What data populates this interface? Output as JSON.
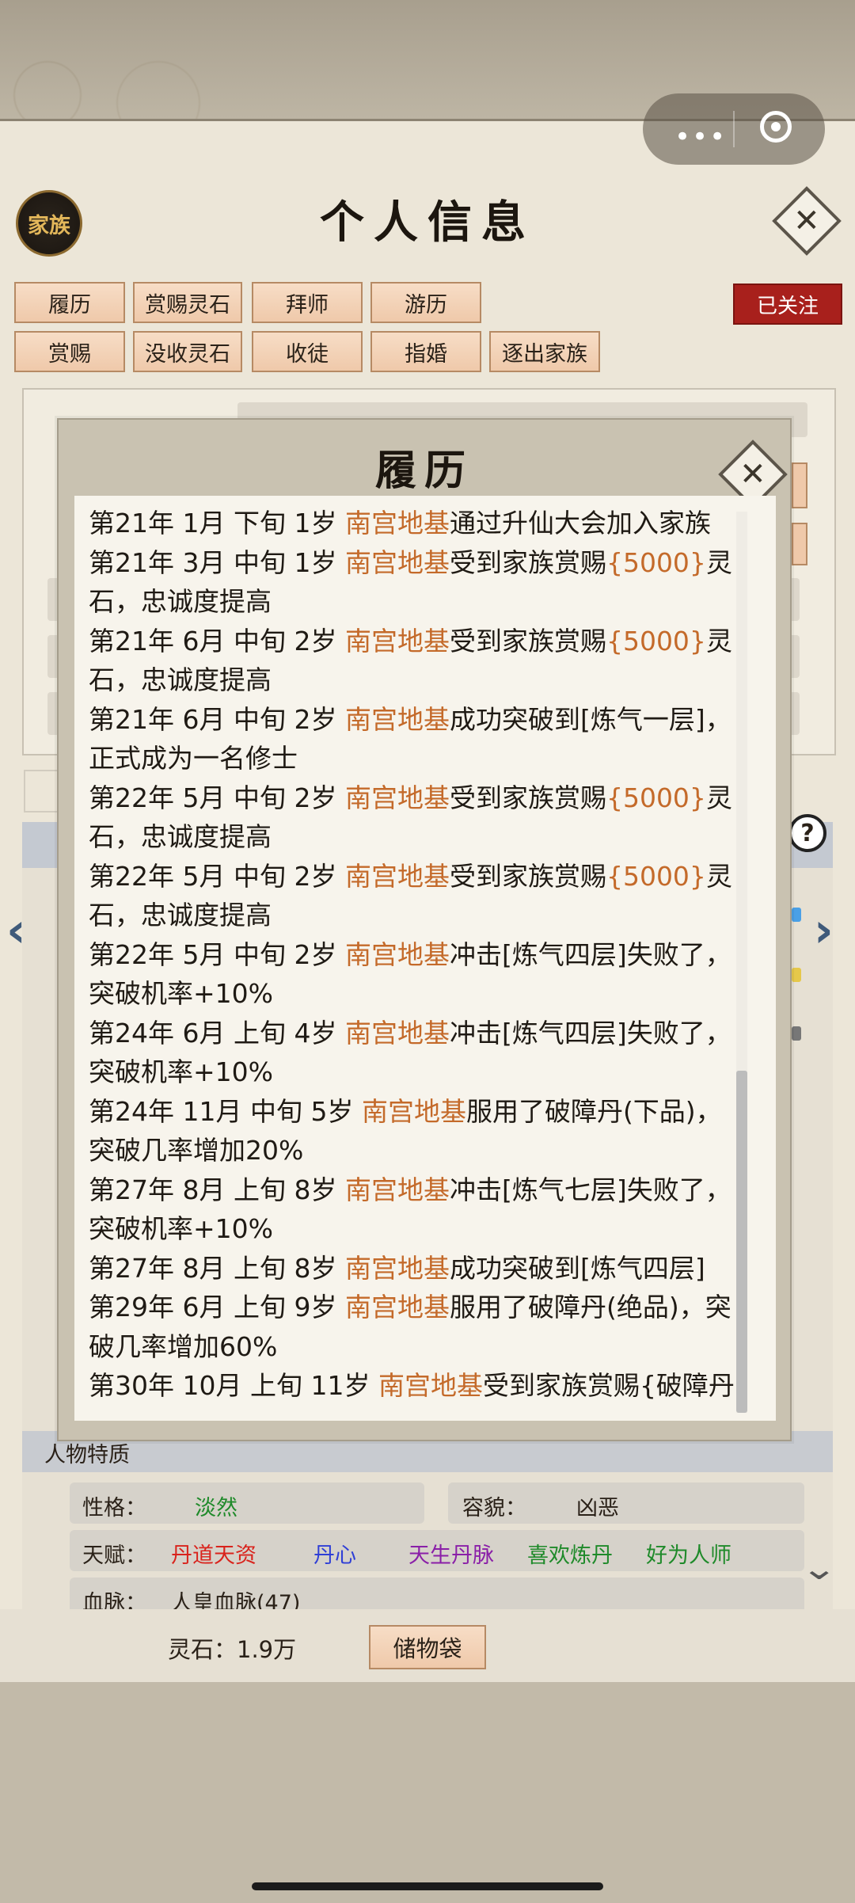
{
  "header": {
    "family_label": "家族",
    "title": "个人信息",
    "close_symbol": "✕"
  },
  "actions": {
    "row1": [
      "履历",
      "赏赐灵石",
      "拜师",
      "游历"
    ],
    "row2": [
      "赏赐",
      "没收灵石",
      "收徒",
      "指婚",
      "逐出家族"
    ],
    "followed_label": "已关注"
  },
  "dialog": {
    "title": "履历",
    "close_symbol": "✕",
    "entries": [
      {
        "pre": "第21年 1月 下旬 1岁 ",
        "name": "南宫地基",
        "post": "通过升仙大会加入家族"
      },
      {
        "pre": "第21年 3月 中旬 1岁 ",
        "name": "南宫地基",
        "post": "受到家族赏赐",
        "reward": "{5000}",
        "tail": "灵石，忠诚度提高"
      },
      {
        "pre": "第21年 6月 中旬 2岁 ",
        "name": "南宫地基",
        "post": "受到家族赏赐",
        "reward": "{5000}",
        "tail": "灵石，忠诚度提高"
      },
      {
        "pre": "第21年  6月  中旬   2岁   ",
        "name": "南宫地基",
        "post": "成功突破到[炼气一层]，正式成为一名修士"
      },
      {
        "pre": "第22年 5月 中旬 2岁 ",
        "name": "南宫地基",
        "post": "受到家族赏赐",
        "reward": "{5000}",
        "tail": "灵石，忠诚度提高"
      },
      {
        "pre": "第22年 5月 中旬 2岁 ",
        "name": "南宫地基",
        "post": "受到家族赏赐",
        "reward": "{5000}",
        "tail": "灵石，忠诚度提高"
      },
      {
        "pre": "第22年  5月  中旬   2岁   ",
        "name": "南宫地基",
        "post": "冲击[炼气四层]失败了，突破机率+10%"
      },
      {
        "pre": "第24年  6月  上旬   4岁   ",
        "name": "南宫地基",
        "post": "冲击[炼气四层]失败了，突破机率+10%"
      },
      {
        "pre": "第24年 11月 中旬 5岁 ",
        "name": "南宫地基",
        "post": "服用了破障丹(下品)，突破几率增加20%"
      },
      {
        "pre": "第27年  8月  上旬   8岁   ",
        "name": "南宫地基",
        "post": "冲击[炼气七层]失败了，突破机率+10%"
      },
      {
        "pre": "第27年 8月 上旬 8岁 ",
        "name": "南宫地基",
        "post": "成功突破到[炼气四层]"
      },
      {
        "pre": "第29年 6月 上旬 9岁 ",
        "name": "南宫地基",
        "post": "服用了破障丹(绝品)，突破几率增加60%"
      },
      {
        "pre": "第30年 10月 上旬 11岁 ",
        "name": "南宫地基",
        "post": "受到家族赏赐{破障丹"
      }
    ]
  },
  "traits": {
    "title": "人物特质",
    "personality_label": "性格：",
    "personality_value": "淡然",
    "looks_label": "容貌：",
    "looks_value": "凶恶",
    "talent_label": "天赋：",
    "talents": [
      {
        "text": "丹道天资",
        "color": "#d9231c"
      },
      {
        "text": "丹心",
        "color": "#2f3fd6"
      },
      {
        "text": "天生丹脉",
        "color": "#8a1fa8"
      },
      {
        "text": "喜欢炼丹",
        "color": "#1f8a2a"
      },
      {
        "text": "好为人师",
        "color": "#1f8a2a"
      }
    ],
    "bloodline_label": "血脉：",
    "bloodline_value": "人皇血脉(47)"
  },
  "footer": {
    "spirit_stone": "灵石：1.9万",
    "bag_label": "储物袋"
  },
  "colors": {
    "highlight": "#c46a2a",
    "personality": "#1f8a2a",
    "followed_bg": "#a8201c"
  }
}
